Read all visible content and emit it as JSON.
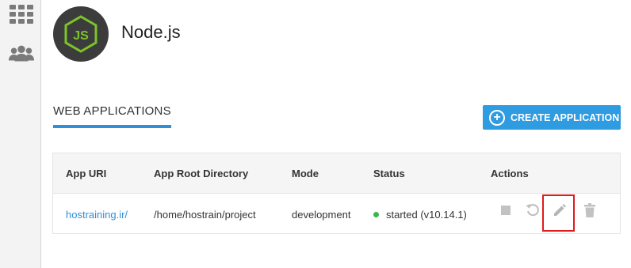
{
  "sidebar": {
    "items": [
      {
        "icon": "grid-icon"
      },
      {
        "icon": "users-icon"
      }
    ]
  },
  "header": {
    "logo_icon": "nodejs-logo-icon",
    "title": "Node.js"
  },
  "section": {
    "tab_label": "WEB APPLICATIONS"
  },
  "toolbar": {
    "create_label": "CREATE APPLICATION",
    "create_icon": "plus-circle-icon"
  },
  "table": {
    "columns": [
      "App URI",
      "App Root Directory",
      "Mode",
      "Status",
      "Actions"
    ],
    "rows": [
      {
        "app_uri": "hostraining.ir/",
        "root_dir": "/home/hostrain/project",
        "mode": "development",
        "status": "started (v10.14.1)",
        "status_color": "#3cb54a",
        "actions": [
          "stop-icon",
          "restart-icon",
          "edit-icon",
          "delete-icon"
        ]
      }
    ]
  },
  "colors": {
    "accent": "#2f9be0",
    "link": "#2f8fd8",
    "highlight": "#e01b1b"
  }
}
